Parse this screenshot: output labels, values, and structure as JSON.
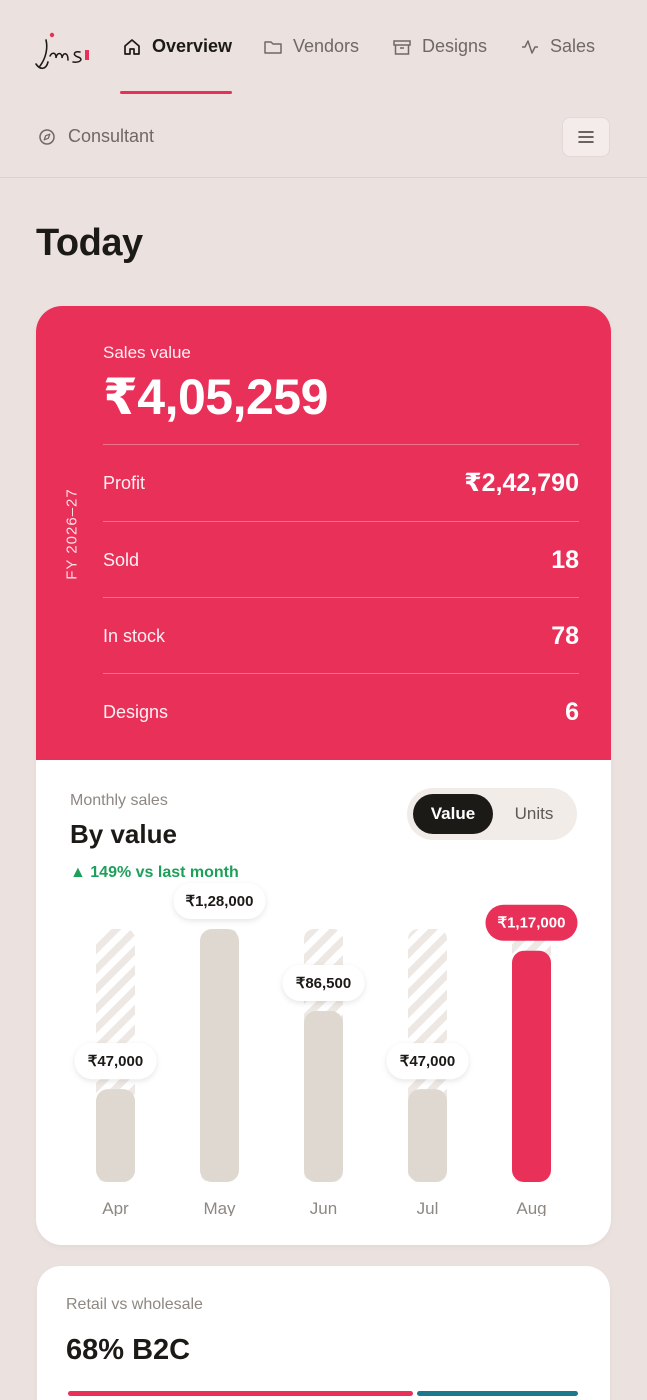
{
  "nav": {
    "items": [
      {
        "label": "Overview",
        "icon": "home-icon",
        "active": true
      },
      {
        "label": "Vendors",
        "icon": "folder-icon",
        "active": false
      },
      {
        "label": "Designs",
        "icon": "archive-icon",
        "active": false
      },
      {
        "label": "Sales",
        "icon": "activity-icon",
        "active": false
      }
    ],
    "secondary": {
      "label": "Consultant",
      "icon": "compass-icon"
    },
    "menu_icon": "hamburger-menu-icon",
    "accent": "#e9305a"
  },
  "page": {
    "title": "Today"
  },
  "summary": {
    "period": "FY 2026–27",
    "sales_label": "Sales value",
    "sales_value": "₹4,05,259",
    "rows": [
      {
        "label": "Profit",
        "value": "₹2,42,790"
      },
      {
        "label": "Sold",
        "value": "18"
      },
      {
        "label": "In stock",
        "value": "78"
      },
      {
        "label": "Designs",
        "value": "6"
      }
    ],
    "background": "#e93059"
  },
  "monthly": {
    "label": "Monthly sales",
    "title": "By value",
    "change": "▲ 149% vs last month",
    "change_color": "#1ea05a",
    "toggle": {
      "options": [
        "Value",
        "Units"
      ],
      "selected": "Value"
    }
  },
  "chart_data": {
    "type": "bar",
    "categories": [
      "Apr",
      "May",
      "Jun",
      "Jul",
      "Aug"
    ],
    "values": [
      47000,
      128000,
      86500,
      47000,
      117000
    ],
    "labels": [
      "₹47,000",
      "₹1,28,000",
      "₹86,500",
      "₹47,000",
      "₹1,17,000"
    ],
    "highlight_index": 4,
    "highlight_color": "#e93059",
    "bar_color": "#dfd8d0",
    "ylim": [
      0,
      128000
    ],
    "grid": false
  },
  "retail": {
    "label": "Retail vs wholesale",
    "value": "68% B2C",
    "b2c_fraction": 0.68,
    "colors": {
      "b2c": "#e93059",
      "b2b": "#1a7a8c"
    }
  }
}
